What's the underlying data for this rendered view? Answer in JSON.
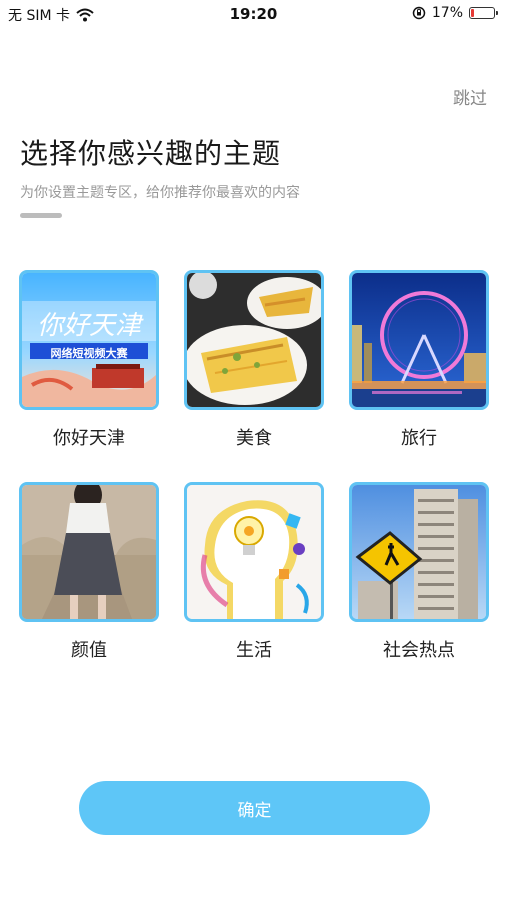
{
  "status_bar": {
    "carrier": "无 SIM 卡",
    "time": "19:20",
    "battery_percent": "17%",
    "battery_level": 0.17,
    "icons": [
      "wifi-icon",
      "orientation-lock-icon",
      "battery-icon"
    ]
  },
  "header": {
    "skip_label": "跳过",
    "title": "选择你感兴趣的主题",
    "subtitle": "为你设置主题专区，给你推荐你最喜欢的内容"
  },
  "topics": [
    {
      "label": "你好天津",
      "banner_text": "你好天津",
      "banner_subtext": "网络短视频大赛"
    },
    {
      "label": "美食"
    },
    {
      "label": "旅行"
    },
    {
      "label": "颜值"
    },
    {
      "label": "生活"
    },
    {
      "label": "社会热点"
    }
  ],
  "confirm_label": "确定",
  "colors": {
    "accent": "#5ec6f7",
    "tile_border": "#5fc3f3",
    "battery_low": "#e53935"
  }
}
